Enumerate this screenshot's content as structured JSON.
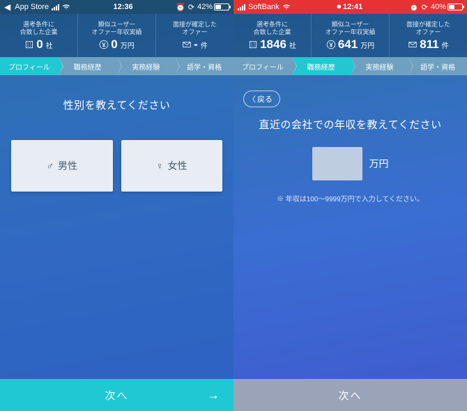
{
  "left": {
    "status": {
      "back": "App Store",
      "time": "12:36",
      "battery_pct": "42%",
      "battery_fill": 0.42
    },
    "metrics": [
      {
        "label": "選考条件に\n合致した企業",
        "value": "0",
        "unit": "社",
        "icon": "building"
      },
      {
        "label": "類似ユーザー\nオファー年収実績",
        "value": "0",
        "unit": "万円",
        "icon": "yen"
      },
      {
        "label": "面接が確定した\nオファー",
        "value": "-",
        "unit": "件",
        "icon": "mail"
      }
    ],
    "tabs": [
      "プロフィール",
      "職務経歴",
      "実務経験",
      "語学・資格"
    ],
    "active_tab": 0,
    "question": "性別を教えてください",
    "options": {
      "male": "男性",
      "female": "女性"
    },
    "next": "次へ"
  },
  "right": {
    "status": {
      "carrier": "SoftBank",
      "time": "12:41",
      "battery_pct": "40%",
      "battery_fill": 0.4
    },
    "metrics": [
      {
        "label": "選考条件に\n合致した企業",
        "value": "1846",
        "unit": "社",
        "icon": "building"
      },
      {
        "label": "類似ユーザー\nオファー年収実績",
        "value": "641",
        "unit": "万円",
        "icon": "yen"
      },
      {
        "label": "面接が確定した\nオファー",
        "value": "811",
        "unit": "件",
        "icon": "mail"
      }
    ],
    "tabs": [
      "プロフィール",
      "職務経歴",
      "実務経験",
      "語学・資格"
    ],
    "active_tab": 1,
    "back": "戻る",
    "question": "直近の会社での年収を教えてください",
    "salary_unit": "万円",
    "hint": "年収は100〜9999万円で入力してください。",
    "next": "次へ"
  }
}
